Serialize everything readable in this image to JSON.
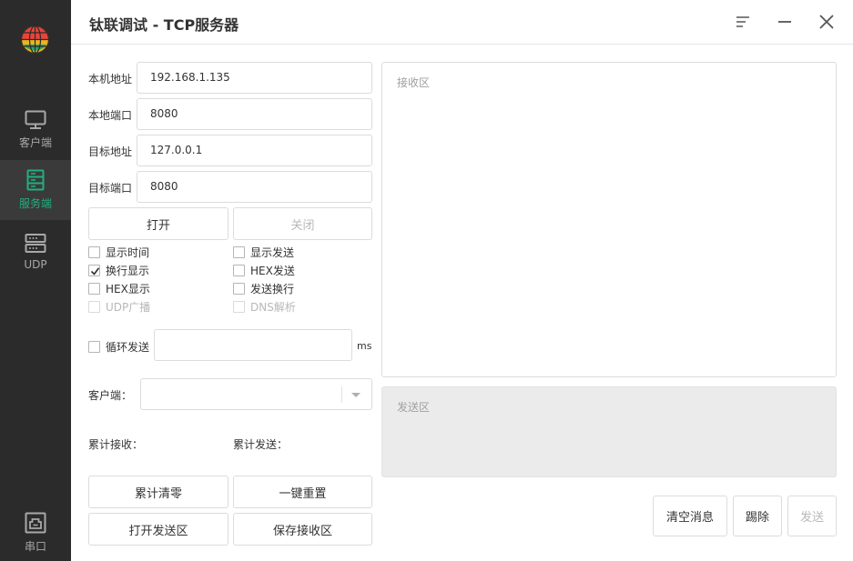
{
  "app": {
    "title": "钛联调试 - TCP服务器"
  },
  "sidebar": {
    "items": [
      {
        "label": "客户端",
        "icon": "monitor-icon"
      },
      {
        "label": "服务端",
        "icon": "server-icon"
      },
      {
        "label": "UDP",
        "icon": "udp-icon"
      },
      {
        "label": "串口",
        "icon": "serial-port-icon"
      }
    ],
    "active": "服务端",
    "active_color": "#21b07d"
  },
  "form": {
    "local_address_label": "本机地址",
    "local_address_value": "192.168.1.135",
    "local_port_label": "本地端口",
    "local_port_value": "8080",
    "target_address_label": "目标地址",
    "target_address_value": "127.0.0.1",
    "target_port_label": "目标端口",
    "target_port_value": "8080",
    "open_label": "打开",
    "close_label": "关闭"
  },
  "options": {
    "show_time": {
      "label": "显示时间",
      "checked": false
    },
    "show_send": {
      "label": "显示发送",
      "checked": false
    },
    "wrap_display": {
      "label": "换行显示",
      "checked": true
    },
    "hex_send": {
      "label": "HEX发送",
      "checked": false
    },
    "hex_display": {
      "label": "HEX显示",
      "checked": false
    },
    "send_newline": {
      "label": "发送换行",
      "checked": false
    },
    "udp_broadcast": {
      "label": "UDP广播",
      "checked": false,
      "disabled": true
    },
    "dns_resolve": {
      "label": "DNS解析",
      "checked": false,
      "disabled": true
    }
  },
  "loop": {
    "label": "循环发送",
    "value": "",
    "unit": "ms"
  },
  "client": {
    "label": "客户端：",
    "selected": ""
  },
  "stats": {
    "received_label": "累计接收：",
    "sent_label": "累计发送："
  },
  "actions": {
    "clear_counters": "累计清零",
    "reset_all": "一键重置",
    "open_send_area": "打开发送区",
    "save_receive_area": "保存接收区",
    "clear_messages": "清空消息",
    "kick": "踢除",
    "send": "发送"
  },
  "receive_area": {
    "placeholder": "接收区"
  },
  "send_area": {
    "placeholder": "发送区"
  }
}
